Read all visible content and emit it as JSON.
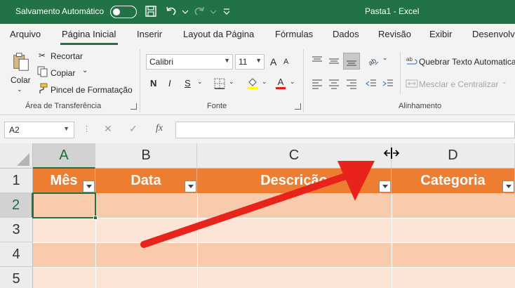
{
  "titlebar": {
    "autosave_label": "Salvamento Automático",
    "doc_title": "Pasta1  -  Excel",
    "icons": [
      "save-icon",
      "undo-icon",
      "redo-icon",
      "customize-qat-icon"
    ]
  },
  "tabs": [
    "Arquivo",
    "Página Inicial",
    "Inserir",
    "Layout da Página",
    "Fórmulas",
    "Dados",
    "Revisão",
    "Exibir",
    "Desenvolvedor"
  ],
  "ribbon": {
    "clipboard": {
      "paste": "Colar",
      "cut": "Recortar",
      "copy": "Copiar",
      "format_painter": "Pincel de Formatação",
      "label": "Área de Transferência"
    },
    "font": {
      "font_name": "Calibri",
      "font_size": "11",
      "bold": "N",
      "italic": "I",
      "underline": "S",
      "grow": "A",
      "shrink": "A",
      "font_color_letter": "A",
      "label": "Fonte"
    },
    "alignment": {
      "wrap_text": "Quebrar Texto Automaticamente",
      "merge_center": "Mesclar e Centralizar",
      "label": "Alinhamento"
    }
  },
  "formula_bar": {
    "name_box": "A2",
    "fx": "fx",
    "value": ""
  },
  "sheet": {
    "columns": [
      "A",
      "B",
      "C",
      "D"
    ],
    "rows": [
      "1",
      "2",
      "3",
      "4",
      "5"
    ],
    "headers": [
      "Mês",
      "Data",
      "Descrição",
      "Categoria"
    ],
    "active_cell": "A2"
  },
  "colors": {
    "excel_green": "#217346",
    "header_orange": "#ed7d31",
    "band_dark": "#f8cbad",
    "band_light": "#fce4d6",
    "arrow_red": "#e8231c"
  }
}
